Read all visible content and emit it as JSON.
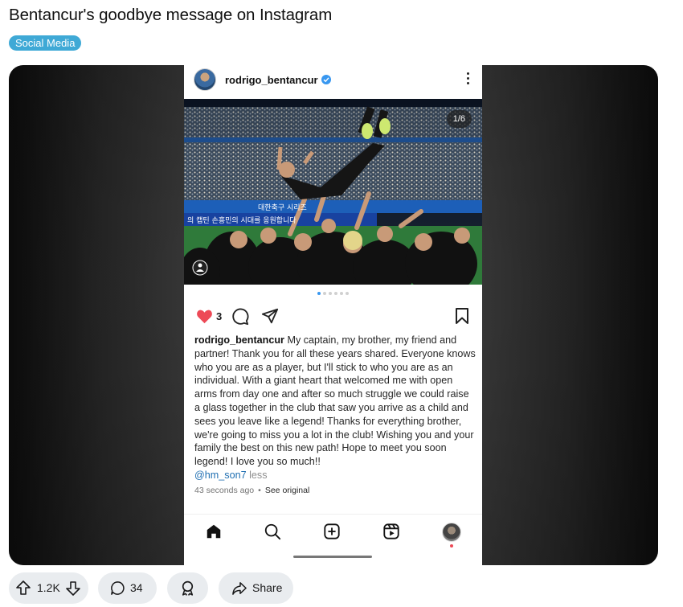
{
  "post": {
    "title": "Bentancur's goodbye message on Instagram",
    "flair": "Social Media"
  },
  "instagram": {
    "username": "rodrigo_bentancur",
    "verified": true,
    "image_counter": "1/6",
    "carousel": {
      "count": 6,
      "active": 1
    },
    "likes": "3",
    "caption_user": "rodrigo_bentancur",
    "caption_text": "My captain, my brother, my friend and partner! Thank you for all these years shared. Everyone knows who you are as a player, but I'll stick to who you are as an individual. With a giant heart that welcomed me with open arms from day one and after so much struggle we could raise a glass together in the club that saw you arrive as a child and sees you leave like a legend! Thanks for everything brother, we're going to miss you a lot in the club! Wishing you and your family the best on this new path! Hope to meet you soon legend! I love you so much!!",
    "mention": "@hm_son7",
    "less_label": "less",
    "timestamp": "43 seconds ago",
    "separator": "•",
    "see_original": "See original",
    "photo_banner_text": "의 캡틴 손흥민의 시대를 응원합니다",
    "photo_banner_text2": "대한축구 시리즈",
    "colors": {
      "heart": "#ed4956",
      "verified": "#3897f0",
      "mention": "#1f6fb2",
      "flair_bg": "#3fa9d6"
    },
    "nav_icons": [
      "home-icon",
      "search-icon",
      "create-icon",
      "reels-icon",
      "profile-avatar"
    ]
  },
  "actions": {
    "votes": "1.2K",
    "comments": "34",
    "share_label": "Share"
  }
}
